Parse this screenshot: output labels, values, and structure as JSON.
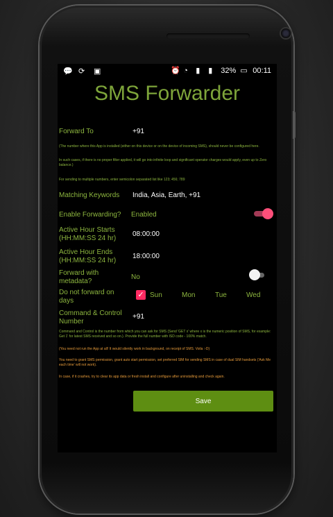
{
  "status_bar": {
    "battery": "32%",
    "time": "00:11",
    "icons_left": [
      "chat-bubble-icon",
      "sync-icon",
      "android-icon"
    ],
    "icons_right": [
      "alarm-icon",
      "wifi-icon",
      "signal-icon",
      "signal-icon-2",
      "battery-icon"
    ]
  },
  "app": {
    "title": "SMS Forwarder",
    "accent_color": "#8db63f",
    "pink_color": "#ff4f7a",
    "save_button_color": "#5e8e12"
  },
  "form": {
    "forward_to_label": "Forward To",
    "forward_to_value": "+91",
    "note1": "(The number where this App is installed (either on this device or on the device of incoming SMS), should never be configured here.",
    "note2": "In such cases, if there is no proper filter applied, it will go into infinite loop and significant operator charges would apply, even up to Zero balance.)",
    "note3": "For sending to multiple numbers, enter semicolon separated list like 123; 456; 789",
    "matching_keywords_label": "Matching Keywords",
    "matching_keywords_value": "India, Asia, Earth, +91",
    "enable_forwarding_label": "Enable Forwarding?",
    "enable_forwarding_value": "Enabled",
    "active_start_label": "Active Hour Starts (HH:MM:SS 24 hr)",
    "active_start_value": "08:00:00",
    "active_end_label": "Active Hour Ends (HH:MM:SS 24 hr)",
    "active_end_value": "18:00:00",
    "metadata_label": "Forward with metadata?",
    "metadata_value": "No",
    "do_not_forward_label": "Do not forward on days",
    "days": [
      "Sun",
      "Mon",
      "Tue",
      "Wed"
    ],
    "command_label": "Command & Control Number",
    "command_value": "+91",
    "info1": "Command and Control is the number from which you can ask for SMS (Send 'GET x' where x is the numeric position of SMS, for example: Get 1' for latest SMS received and so on.). Provide the full number with ISD code - 100% match.",
    "info2": "(You need not run the App at all! It would silently work in background, on receipt of SMS. Voila :-D)",
    "info3": "You need to grant SMS permission, grant auto start permission, set preferred SIM for sending SMS in case of dual SIM handsets ('Ask Me each time' will not work).",
    "info4": "In case, if it crashes, try to clear its app data or fresh install and configure after uninstalling and check again.",
    "save_label": "Save"
  }
}
